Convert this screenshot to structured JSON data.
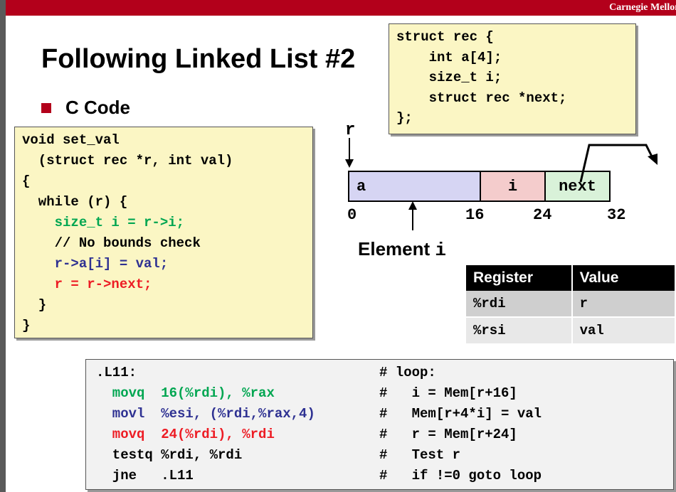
{
  "header": {
    "brand": "Carnegie Mellon"
  },
  "title": "Following Linked List #2",
  "bullet": "C Code",
  "struct_code": {
    "lines": [
      "struct rec {",
      "    int a[4];",
      "    size_t i;",
      "    struct rec *next;",
      "};"
    ]
  },
  "c_code": {
    "line1": "void set_val",
    "line2": "  (struct rec *r, int val)",
    "line3": "{",
    "line4": "  while (r) {",
    "line5": "    size_t i = r->i;",
    "line6": "    // No bounds check",
    "line7": "    r->a[i] = val;",
    "line8": "    r = r->next;",
    "line9": "  }",
    "line10": "}"
  },
  "diagram": {
    "pointer_label": "r",
    "fields": {
      "a": "a",
      "i": "i",
      "next": "next"
    },
    "offsets": [
      "0",
      "16",
      "24",
      "32"
    ],
    "element_label_prefix": "Element ",
    "element_label_var": "i"
  },
  "register_table": {
    "headers": [
      "Register",
      "Value"
    ],
    "rows": [
      {
        "register": "%rdi",
        "value": "r"
      },
      {
        "register": "%rsi",
        "value": "val"
      }
    ]
  },
  "assembly": {
    "left": [
      ".L11:",
      "  movq  16(%rdi), %rax",
      "  movl  %esi, (%rdi,%rax,4)",
      "  movq  24(%rdi), %rdi",
      "  testq %rdi, %rdi",
      "  jne   .L11"
    ],
    "right": [
      "# loop:",
      "#   i = Mem[r+16]",
      "#   Mem[r+4*i] = val",
      "#   r = Mem[r+24]",
      "#   Test r",
      "#   if !=0 goto loop"
    ]
  },
  "colors": {
    "brand_red": "#b3001b",
    "code_green": "#00a651",
    "code_blue": "#2e3192",
    "code_red": "#ed1c24",
    "code_box_bg": "#fbf6c4",
    "field_a_bg": "#d6d5f3",
    "field_i_bg": "#f4cccc",
    "field_next_bg": "#d9f2d9"
  }
}
